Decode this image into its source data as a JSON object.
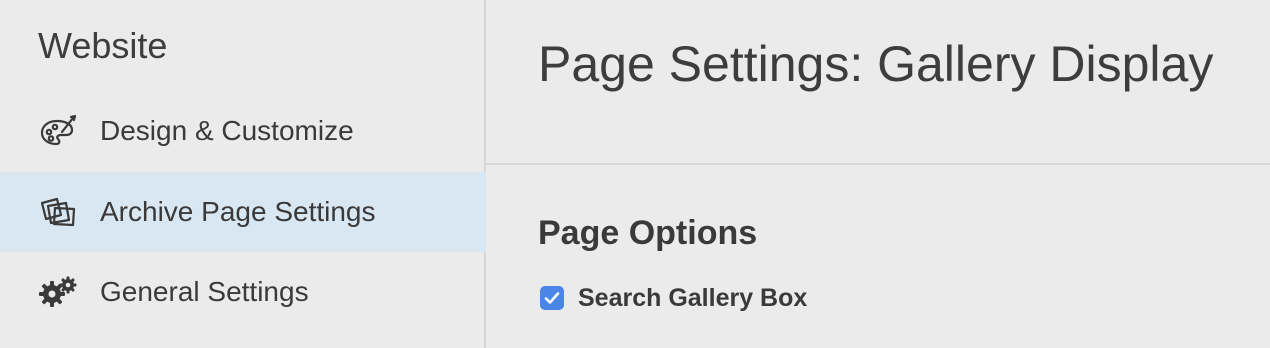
{
  "sidebar": {
    "title": "Website",
    "items": [
      {
        "label": "Design & Customize",
        "icon": "palette-icon",
        "active": false
      },
      {
        "label": "Archive Page Settings",
        "icon": "photos-icon",
        "active": true
      },
      {
        "label": "General Settings",
        "icon": "gears-icon",
        "active": false
      }
    ]
  },
  "main": {
    "title": "Page Settings: Gallery Display",
    "section_title": "Page Options",
    "options": [
      {
        "label": "Search Gallery Box",
        "checked": true
      }
    ]
  },
  "colors": {
    "background": "#ebebeb",
    "active_item": "#d9e7f3",
    "checkbox": "#4a86e8",
    "text": "#3a3a3a",
    "divider": "#d6d6d6"
  }
}
